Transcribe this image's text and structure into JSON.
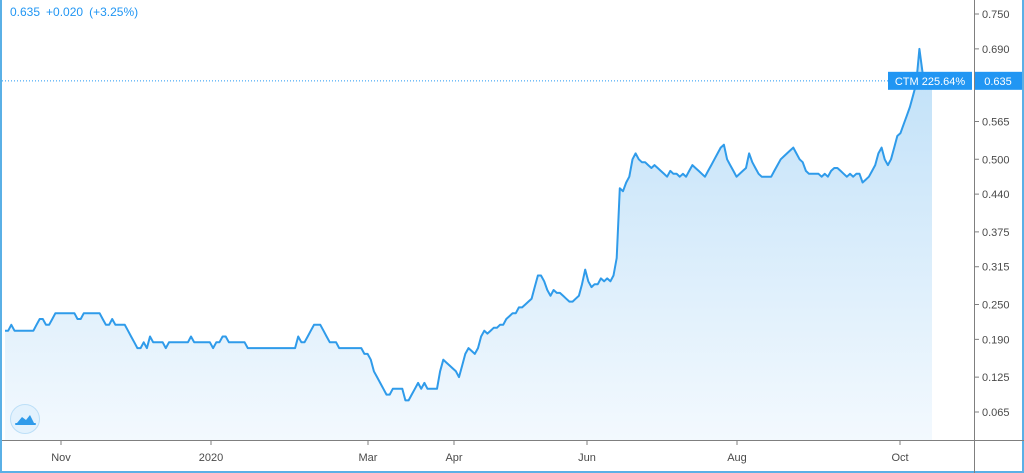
{
  "ticker": {
    "price": "0.635",
    "change": "+0.020",
    "change_pct": "(+3.25%)"
  },
  "price_label": {
    "symbol_change": "CTM 225.64%",
    "price": "0.635"
  },
  "colors": {
    "line": "#2f9bea",
    "area_top": "#bfe0f8",
    "area_bottom": "#f3f9fe",
    "accent": "#2196f3",
    "frame": "#5ab0e6"
  },
  "icons": {
    "logo": "tradingview-cloud-icon"
  },
  "chart_data": {
    "type": "area",
    "title": "",
    "xlabel": "",
    "ylabel": "",
    "ylim": [
      0.01,
      0.78
    ],
    "y_ticks": [
      "0.750",
      "0.690",
      "0.565",
      "0.500",
      "0.440",
      "0.375",
      "0.315",
      "0.250",
      "0.190",
      "0.125",
      "0.065"
    ],
    "x_ticks": [
      "Nov",
      "2020",
      "Mar",
      "Apr",
      "Jun",
      "Aug",
      "Oct"
    ],
    "last_value": 0.635,
    "grid": false,
    "series": [
      {
        "values": [
          0.205,
          0.205,
          0.215,
          0.205,
          0.205,
          0.205,
          0.205,
          0.205,
          0.205,
          0.205,
          0.215,
          0.225,
          0.225,
          0.215,
          0.215,
          0.225,
          0.235,
          0.235,
          0.235,
          0.235,
          0.235,
          0.235,
          0.235,
          0.225,
          0.225,
          0.235,
          0.235,
          0.235,
          0.235,
          0.235,
          0.235,
          0.225,
          0.215,
          0.215,
          0.225,
          0.215,
          0.215,
          0.215,
          0.215,
          0.205,
          0.195,
          0.185,
          0.175,
          0.175,
          0.185,
          0.175,
          0.195,
          0.185,
          0.185,
          0.185,
          0.185,
          0.175,
          0.185,
          0.185,
          0.185,
          0.185,
          0.185,
          0.185,
          0.185,
          0.195,
          0.185,
          0.185,
          0.185,
          0.185,
          0.185,
          0.185,
          0.175,
          0.185,
          0.185,
          0.195,
          0.195,
          0.185,
          0.185,
          0.185,
          0.185,
          0.185,
          0.185,
          0.175,
          0.175,
          0.175,
          0.175,
          0.175,
          0.175,
          0.175,
          0.175,
          0.175,
          0.175,
          0.175,
          0.175,
          0.175,
          0.175,
          0.175,
          0.175,
          0.195,
          0.185,
          0.185,
          0.195,
          0.205,
          0.215,
          0.215,
          0.215,
          0.205,
          0.195,
          0.185,
          0.185,
          0.185,
          0.175,
          0.175,
          0.175,
          0.175,
          0.175,
          0.175,
          0.175,
          0.175,
          0.165,
          0.165,
          0.155,
          0.135,
          0.125,
          0.115,
          0.105,
          0.095,
          0.095,
          0.105,
          0.105,
          0.105,
          0.105,
          0.085,
          0.085,
          0.095,
          0.105,
          0.115,
          0.105,
          0.115,
          0.105,
          0.105,
          0.105,
          0.105,
          0.135,
          0.155,
          0.15,
          0.145,
          0.14,
          0.135,
          0.125,
          0.145,
          0.165,
          0.175,
          0.17,
          0.165,
          0.175,
          0.195,
          0.205,
          0.2,
          0.205,
          0.21,
          0.21,
          0.215,
          0.215,
          0.225,
          0.23,
          0.235,
          0.235,
          0.245,
          0.245,
          0.25,
          0.255,
          0.26,
          0.28,
          0.3,
          0.3,
          0.29,
          0.275,
          0.265,
          0.275,
          0.27,
          0.27,
          0.265,
          0.26,
          0.255,
          0.255,
          0.26,
          0.265,
          0.285,
          0.31,
          0.29,
          0.28,
          0.285,
          0.285,
          0.295,
          0.29,
          0.295,
          0.29,
          0.3,
          0.33,
          0.45,
          0.445,
          0.46,
          0.47,
          0.5,
          0.51,
          0.5,
          0.495,
          0.495,
          0.49,
          0.485,
          0.49,
          0.485,
          0.48,
          0.475,
          0.47,
          0.48,
          0.475,
          0.475,
          0.47,
          0.475,
          0.47,
          0.48,
          0.49,
          0.485,
          0.48,
          0.475,
          0.47,
          0.48,
          0.49,
          0.5,
          0.51,
          0.52,
          0.525,
          0.5,
          0.49,
          0.48,
          0.47,
          0.475,
          0.48,
          0.485,
          0.51,
          0.495,
          0.485,
          0.475,
          0.47,
          0.47,
          0.47,
          0.47,
          0.48,
          0.49,
          0.5,
          0.505,
          0.51,
          0.515,
          0.52,
          0.51,
          0.5,
          0.495,
          0.48,
          0.475,
          0.475,
          0.475,
          0.475,
          0.47,
          0.475,
          0.47,
          0.48,
          0.485,
          0.485,
          0.48,
          0.475,
          0.47,
          0.475,
          0.47,
          0.475,
          0.475,
          0.46,
          0.465,
          0.47,
          0.48,
          0.49,
          0.51,
          0.52,
          0.5,
          0.49,
          0.5,
          0.52,
          0.54,
          0.545,
          0.56,
          0.575,
          0.59,
          0.61,
          0.63,
          0.69,
          0.65,
          0.63,
          0.64,
          0.635
        ]
      }
    ]
  }
}
